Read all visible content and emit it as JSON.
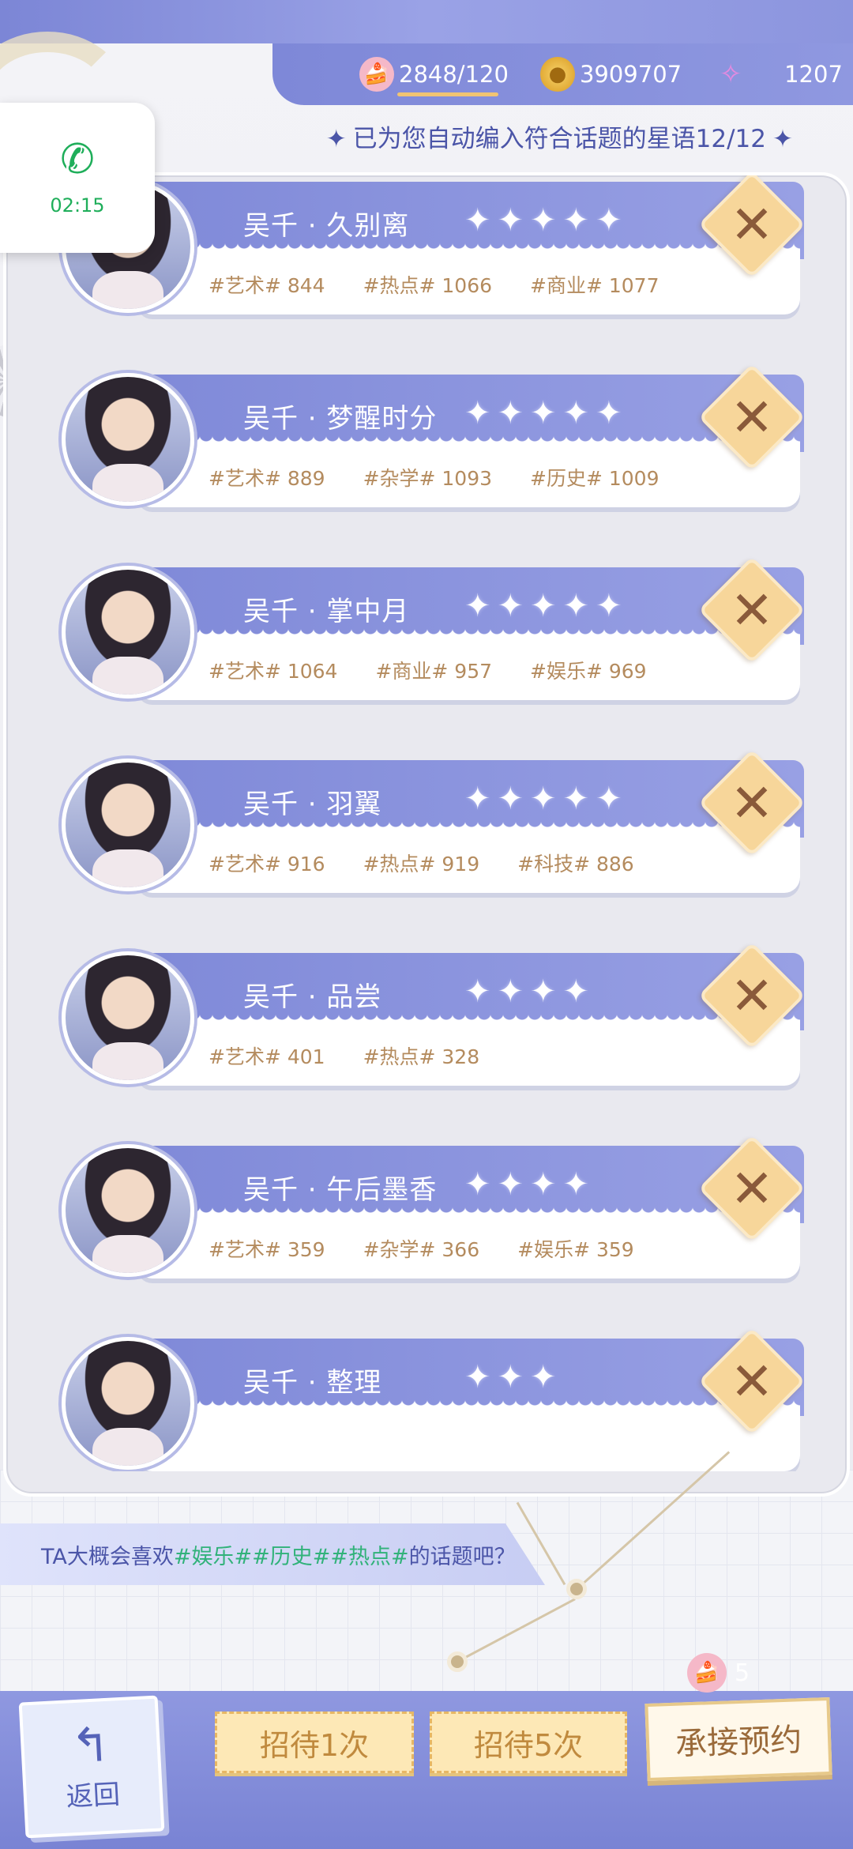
{
  "resources": {
    "stamina": "2848/120",
    "coins": "3909707",
    "gems": "1207"
  },
  "notice": "已为您自动编入符合话题的星语12/12",
  "call": {
    "time": "02:15"
  },
  "cards": [
    {
      "title": "吴千 · 久别离",
      "stars": "✦✦✦✦✦",
      "tags": [
        "#艺术# 844",
        "#热点# 1066",
        "#商业# 1077"
      ]
    },
    {
      "title": "吴千 · 梦醒时分",
      "stars": "✦✦✦✦✦",
      "tags": [
        "#艺术# 889",
        "#杂学# 1093",
        "#历史# 1009"
      ]
    },
    {
      "title": "吴千 · 掌中月",
      "stars": "✦✦✦✦✦",
      "tags": [
        "#艺术# 1064",
        "#商业# 957",
        "#娱乐# 969"
      ]
    },
    {
      "title": "吴千 · 羽翼",
      "stars": "✦✦✦✦✦",
      "tags": [
        "#艺术# 916",
        "#热点# 919",
        "#科技# 886"
      ]
    },
    {
      "title": "吴千 · 品尝",
      "stars": "✦✦✦✦",
      "tags": [
        "#艺术# 401",
        "#热点# 328"
      ]
    },
    {
      "title": "吴千 · 午后墨香",
      "stars": "✦✦✦✦",
      "tags": [
        "#艺术# 359",
        "#杂学# 366",
        "#娱乐# 359"
      ]
    },
    {
      "title": "吴千 · 整理",
      "stars": "✦✦✦",
      "tags": []
    }
  ],
  "hint": {
    "prefix": "TA大概会喜欢",
    "topics": "#娱乐##历史##热点#",
    "suffix": "的话题吧？"
  },
  "buttons": {
    "back": "返回",
    "receive_once": "招待1次",
    "receive_five": "招待5次",
    "accept": "承接预约",
    "cake_count": "5"
  },
  "icons": {
    "stamina": "cake-icon",
    "coins": "coin-icon",
    "gems": "gem-icon",
    "phone": "phone-icon",
    "delete": "close-icon",
    "back": "return-arrow-icon"
  },
  "colors": {
    "accent": "#7f89d8",
    "tag_text": "#b48b5e",
    "hint_topic": "#31b27a",
    "call_green": "#1fae5a"
  }
}
